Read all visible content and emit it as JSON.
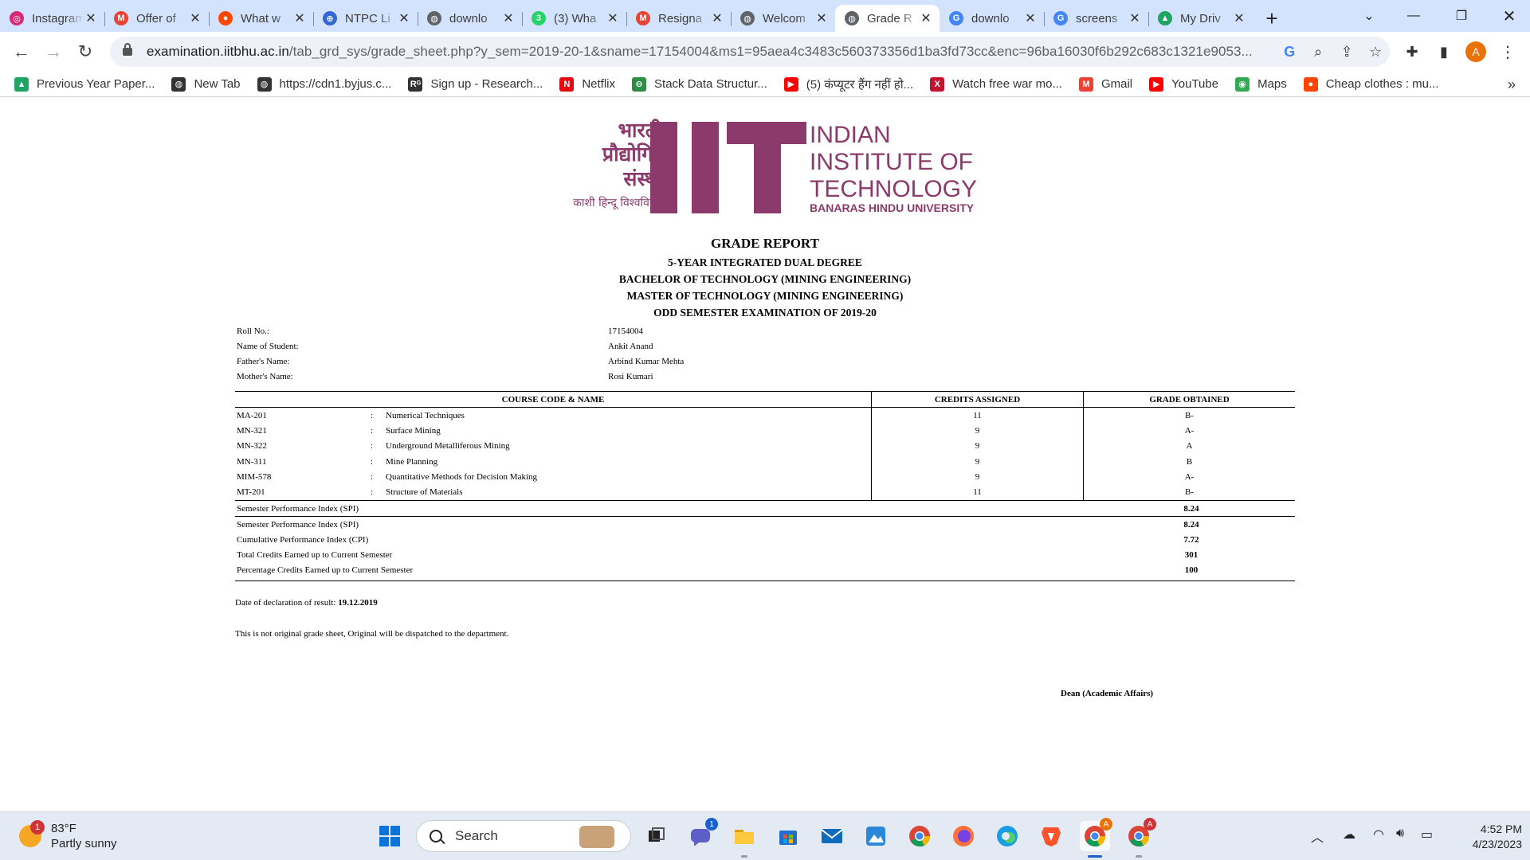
{
  "browser": {
    "tabs": [
      {
        "title": "Instagram",
        "icon": "instagram-icon",
        "color": "#d62976"
      },
      {
        "title": "Offer of",
        "icon": "gmail-icon",
        "color": "#ea4335"
      },
      {
        "title": "What w",
        "icon": "reddit-icon",
        "color": "#ff4500"
      },
      {
        "title": "NTPC Li",
        "icon": "ntpc-icon",
        "color": "#3367d6"
      },
      {
        "title": "downlo",
        "icon": "globe-icon",
        "color": "#5f6368"
      },
      {
        "title": "(3) Wha",
        "icon": "whatsapp-icon",
        "color": "#25d366"
      },
      {
        "title": "Resigna",
        "icon": "gmail-icon",
        "color": "#ea4335"
      },
      {
        "title": "Welcom",
        "icon": "globe-icon",
        "color": "#5f6368"
      },
      {
        "title": "Grade R",
        "icon": "globe-icon",
        "color": "#5f6368"
      },
      {
        "title": "downlo",
        "icon": "google-icon",
        "color": "#4285f4"
      },
      {
        "title": "screens",
        "icon": "google-icon",
        "color": "#4285f4"
      },
      {
        "title": "My Driv",
        "icon": "drive-icon",
        "color": "#1fa463"
      }
    ],
    "active_tab_index": 8,
    "url_host": "examination.iitbhu.ac.in",
    "url_path": "/tab_grd_sys/grade_sheet.php?y_sem=2019-20-1&sname=17154004&ms1=95aea4c3483c560373356d1ba3fd73cc&enc=96ba16030f6b292c683c1321e9053...",
    "profile_initial": "A",
    "bookmarks": [
      {
        "label": "Previous Year Paper...",
        "icon": "drive-icon",
        "color": "#1fa463"
      },
      {
        "label": "New Tab",
        "icon": "globe-icon",
        "color": "#333333"
      },
      {
        "label": "https://cdn1.byjus.c...",
        "icon": "globe-icon",
        "color": "#333333"
      },
      {
        "label": "Sign up - Research...",
        "icon": "researchgate-icon",
        "color": "#333333"
      },
      {
        "label": "Netflix",
        "icon": "netflix-icon",
        "color": "#e50914"
      },
      {
        "label": "Stack Data Structur...",
        "icon": "gfg-icon",
        "color": "#2f8d46"
      },
      {
        "label": "(5) कंप्यूटर हैंग नहीं हो...",
        "icon": "youtube-icon",
        "color": "#ff0000"
      },
      {
        "label": "Watch free war mo...",
        "icon": "x-icon",
        "color": "#c4122f"
      },
      {
        "label": "Gmail",
        "icon": "gmail-icon",
        "color": "#ea4335"
      },
      {
        "label": "YouTube",
        "icon": "youtube-icon",
        "color": "#ff0000"
      },
      {
        "label": "Maps",
        "icon": "maps-icon",
        "color": "#34a853"
      },
      {
        "label": "Cheap clothes : mu...",
        "icon": "reddit-icon",
        "color": "#ff4500"
      }
    ]
  },
  "report": {
    "logo": {
      "hindi_lines": [
        "भारतीय",
        "प्रौद्योगिकी",
        "संस्थान"
      ],
      "hindi_sub": "काशी हिन्दू विश्वविद्यालय",
      "english_lines": [
        "INDIAN",
        "INSTITUTE OF",
        "TECHNOLOGY"
      ],
      "english_sub": "BANARAS HINDU UNIVERSITY",
      "brand_color": "#8b3a6b"
    },
    "heading": "GRADE REPORT",
    "subheadings": [
      "5-YEAR INTEGRATED DUAL DEGREE",
      "BACHELOR OF TECHNOLOGY (MINING ENGINEERING)",
      "MASTER OF TECHNOLOGY (MINING ENGINEERING)",
      "ODD SEMESTER EXAMINATION OF 2019-20"
    ],
    "student": [
      {
        "label": "Roll No.:",
        "value": "17154004"
      },
      {
        "label": "Name of Student:",
        "value": "Ankit Anand"
      },
      {
        "label": "Father's Name:",
        "value": "Arbind Kumar Mehta"
      },
      {
        "label": "Mother's Name:",
        "value": "Rosi Kumari"
      }
    ],
    "columns": [
      "COURSE CODE & NAME",
      "CREDITS ASSIGNED",
      "GRADE OBTAINED"
    ],
    "courses": [
      {
        "code": "MA-201",
        "sep": ":",
        "name": "Numerical Techniques",
        "credits": "11",
        "grade": "B-"
      },
      {
        "code": "MN-321",
        "sep": ":",
        "name": "Surface Mining",
        "credits": "9",
        "grade": "A-"
      },
      {
        "code": "MN-322",
        "sep": ":",
        "name": "Underground Metalliferous Mining",
        "credits": "9",
        "grade": "A"
      },
      {
        "code": "MN-311",
        "sep": ":",
        "name": "Mine Planning",
        "credits": "9",
        "grade": "B"
      },
      {
        "code": "MIM-578",
        "sep": ":",
        "name": "Quantitative Methods for Decision Making",
        "credits": "9",
        "grade": "A-"
      },
      {
        "code": "MT-201",
        "sep": ":",
        "name": "Structure of Materials",
        "credits": "11",
        "grade": "B-"
      }
    ],
    "spi_row": {
      "label": "Semester Performance Index (SPI)",
      "value": "8.24"
    },
    "summary": [
      {
        "label": "Semester Performance Index (SPI)",
        "value": "8.24"
      },
      {
        "label": "Cumulative Performance Index (CPI)",
        "value": "7.72"
      },
      {
        "label": "Total Credits Earned up to Current Semester",
        "value": "301"
      },
      {
        "label": "Percentage Credits Earned up to Current Semester",
        "value": "100"
      }
    ],
    "declaration_label": "Date of declaration of result: ",
    "declaration_date": "19.12.2019",
    "disclaimer": "This is not original grade sheet, Original will be dispatched to the department.",
    "signatory": "Dean (Academic Affairs)"
  },
  "taskbar": {
    "weather_temp": "83°F",
    "weather_desc": "Partly sunny",
    "weather_badge": "1",
    "search_label": "Search",
    "chat_badge": "1",
    "time": "4:52 PM",
    "date": "4/23/2023"
  }
}
